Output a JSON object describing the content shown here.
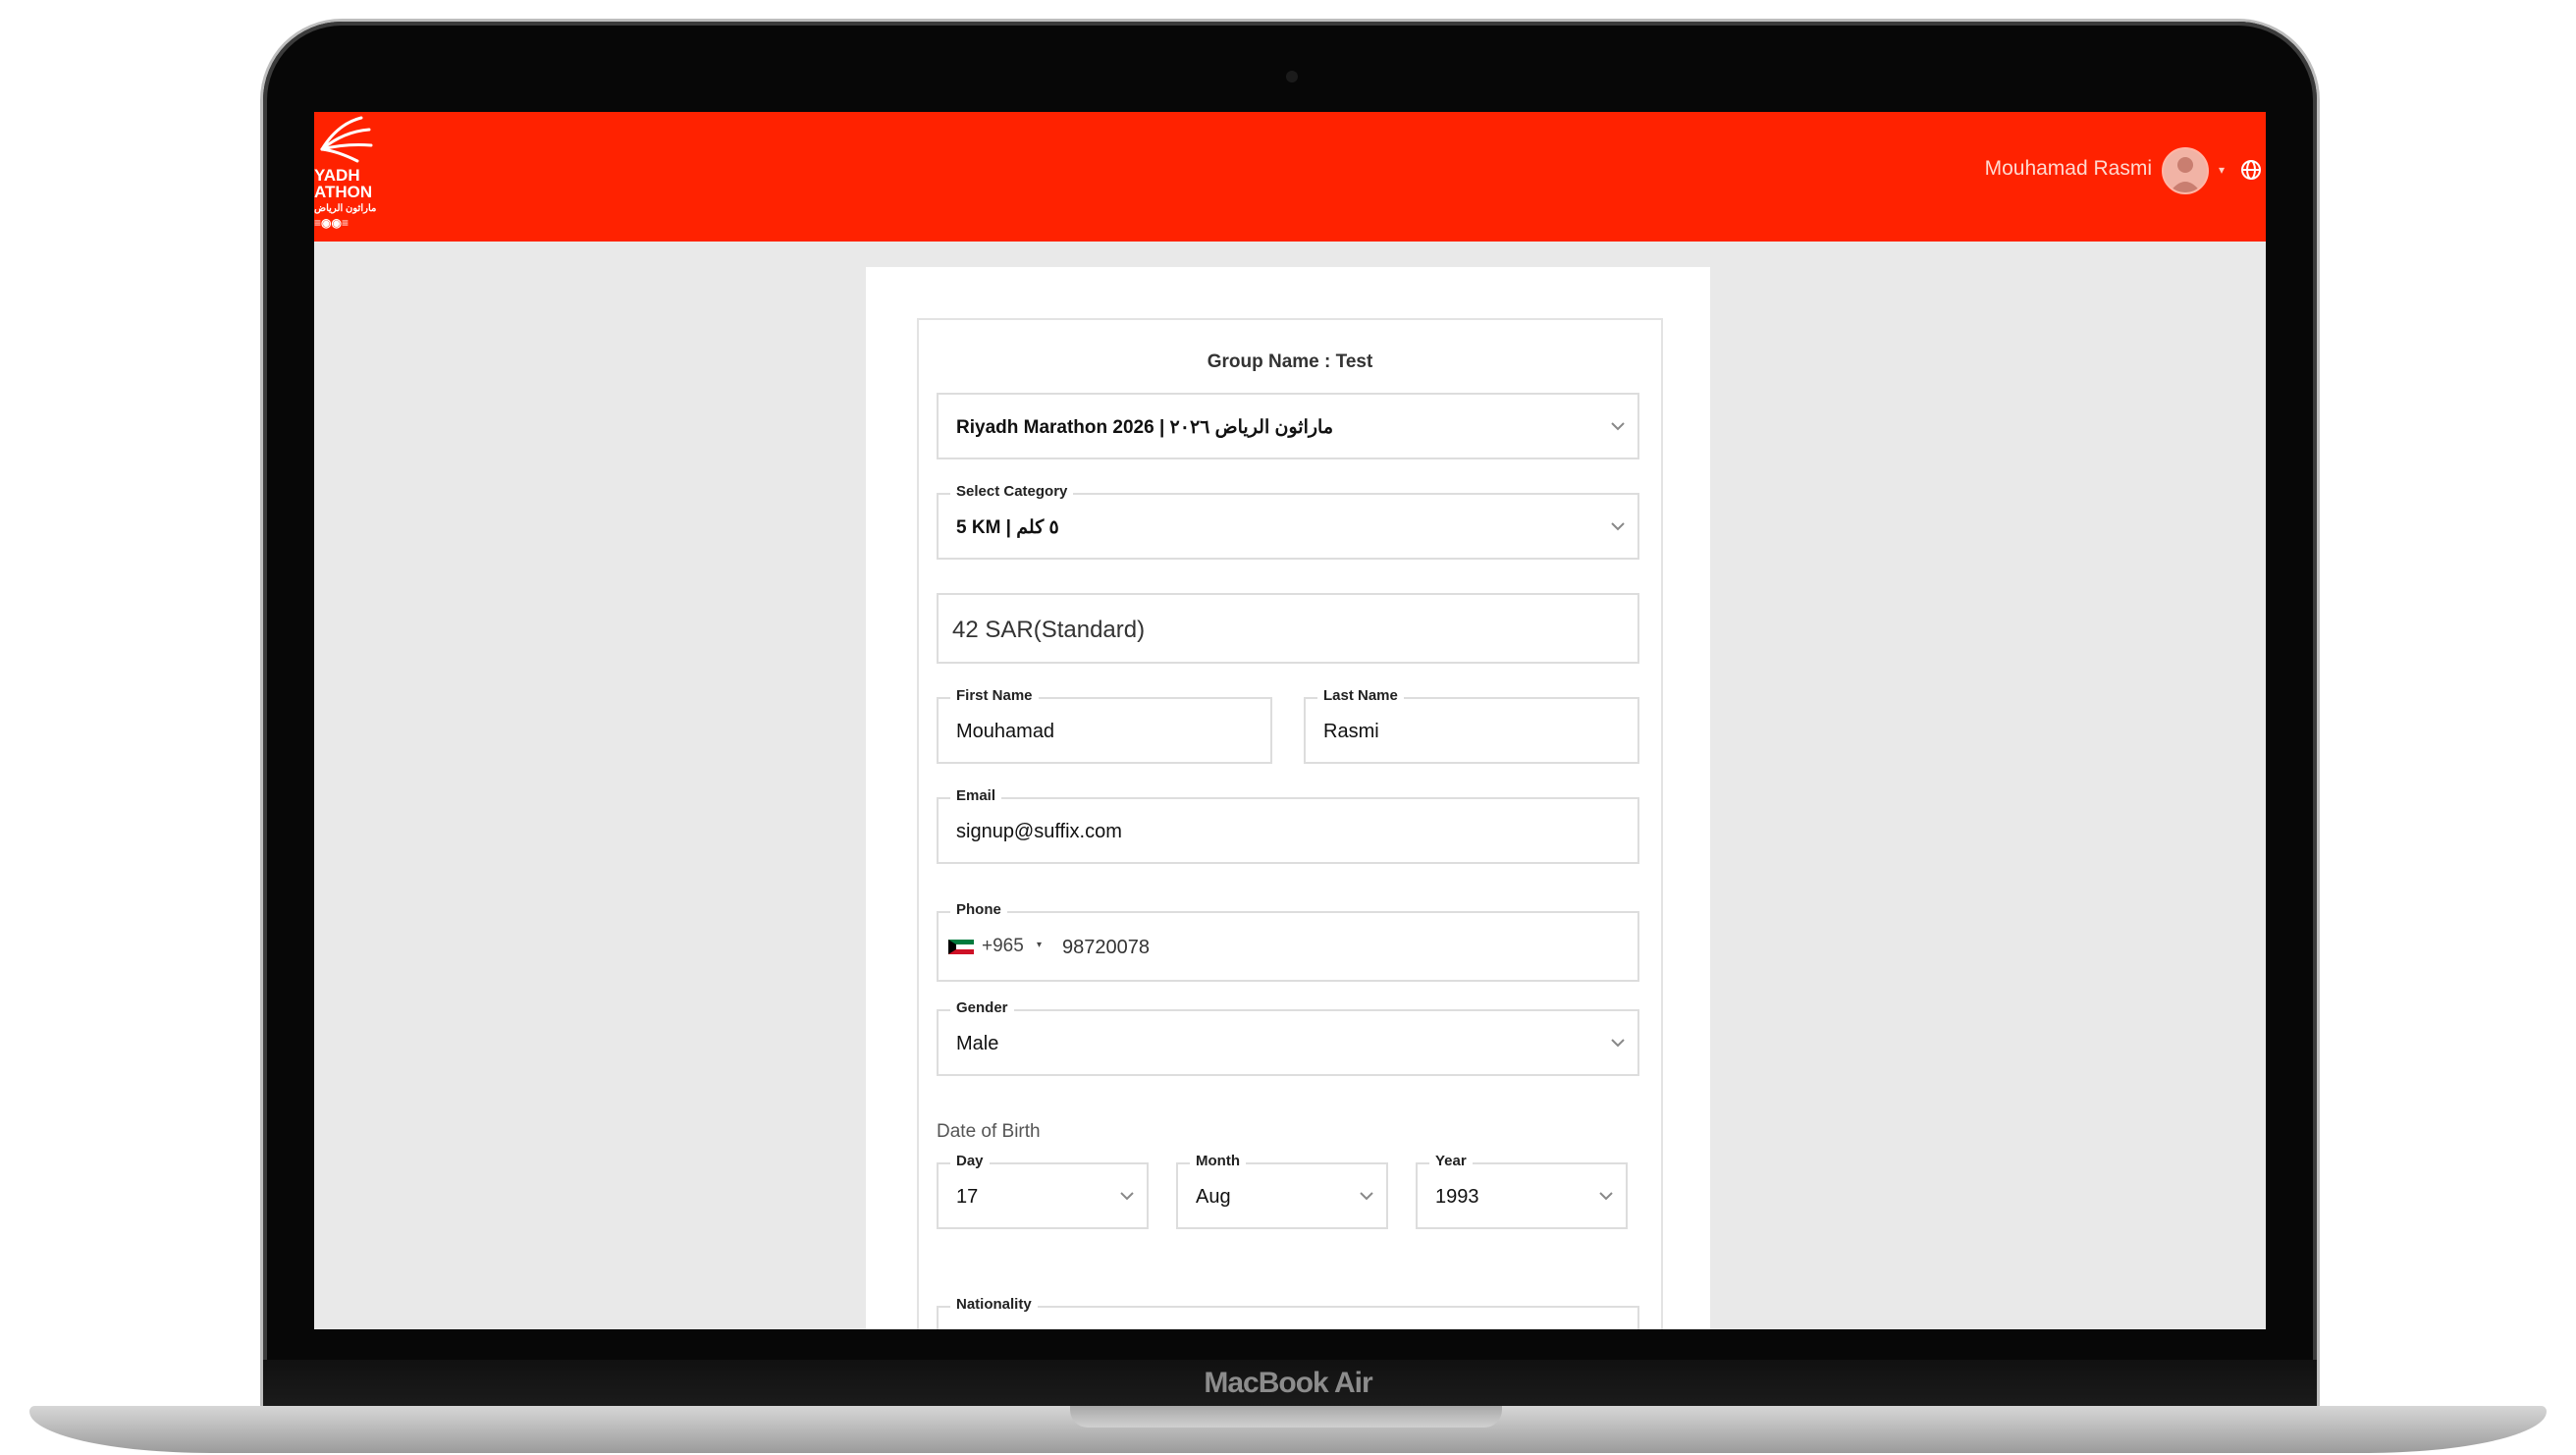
{
  "device": {
    "label": "MacBook Air"
  },
  "header": {
    "logo": {
      "line1": "YADH",
      "line2": "ATHON",
      "line3": "ماراثون الرياض"
    },
    "user_name": "Mouhamad Rasmi",
    "brand_color": "#ff2200",
    "icons": [
      "user-avatar",
      "chevron-down",
      "globe"
    ]
  },
  "form": {
    "group_name": "Group Name : Test",
    "event": {
      "value": "Riyadh Marathon 2026 | ماراثون الرياض ٢٠٢٦"
    },
    "category": {
      "label": "Select Category",
      "value": "5 KM | ٥ كلم"
    },
    "price": {
      "value": "42 SAR(Standard)"
    },
    "first_name": {
      "label": "First Name",
      "value": "Mouhamad"
    },
    "last_name": {
      "label": "Last Name",
      "value": "Rasmi"
    },
    "email": {
      "label": "Email",
      "value": "signup@suffix.com"
    },
    "phone": {
      "label": "Phone",
      "country_code": "+965",
      "value": "98720078"
    },
    "gender": {
      "label": "Gender",
      "value": "Male"
    },
    "dob": {
      "title": "Date of Birth",
      "day": {
        "label": "Day",
        "value": "17"
      },
      "month": {
        "label": "Month",
        "value": "Aug"
      },
      "year": {
        "label": "Year",
        "value": "1993"
      }
    },
    "nationality": {
      "label": "Nationality",
      "value": ""
    }
  }
}
